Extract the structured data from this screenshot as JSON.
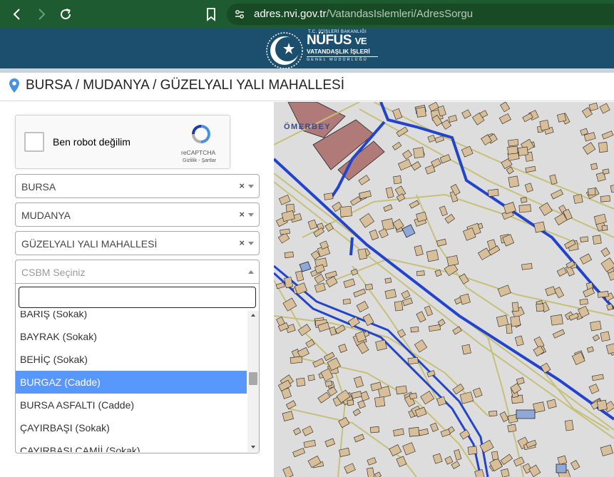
{
  "browser": {
    "url_domain": "adres.nvi.gov.tr",
    "url_path": "/VatandasIslemleri/AdresSorgu"
  },
  "logo": {
    "ministry": "T.C. İÇİŞLERİ BAKANLIĞI",
    "title_main": "NÜFUS",
    "title_ve": "VE",
    "title_sub": "VATANDAŞLIK İŞLERİ",
    "title_tiny": "GENEL MÜDÜRLÜĞÜ"
  },
  "breadcrumb": "BURSA / MUDANYA / GÜZELYALI YALI MAHALLESİ",
  "recaptcha": {
    "label": "Ben robot değilim",
    "brand": "reCAPTCHA",
    "links": "Gizlilik - Şartlar"
  },
  "selects": {
    "province": "BURSA",
    "district": "MUDANYA",
    "neighborhood": "GÜZELYALI YALI MAHALLESİ",
    "csbm_placeholder": "CSBM Seçiniz",
    "clear_symbol": "×"
  },
  "dropdown": {
    "search_value": "",
    "options": [
      "BARIŞ (Sokak)",
      "BAYRAK (Sokak)",
      "BEHİÇ (Sokak)",
      "BURGAZ (Cadde)",
      "BURSA ASFALTI (Cadde)",
      "ÇAYIRBAŞI (Sokak)",
      "ÇAYIRBAŞI CAMİİ (Sokak)"
    ],
    "highlighted": "BURGAZ (Cadde)"
  },
  "map": {
    "label": "ÖMERBEY",
    "colors": {
      "background": "#dddddd",
      "building": "#d8bf9a",
      "building_outline": "#222222",
      "road_outline": "#c7c07a",
      "boundary": "#2244cc",
      "public_building": "#b07a78",
      "water_building": "#8fa8d8"
    }
  }
}
